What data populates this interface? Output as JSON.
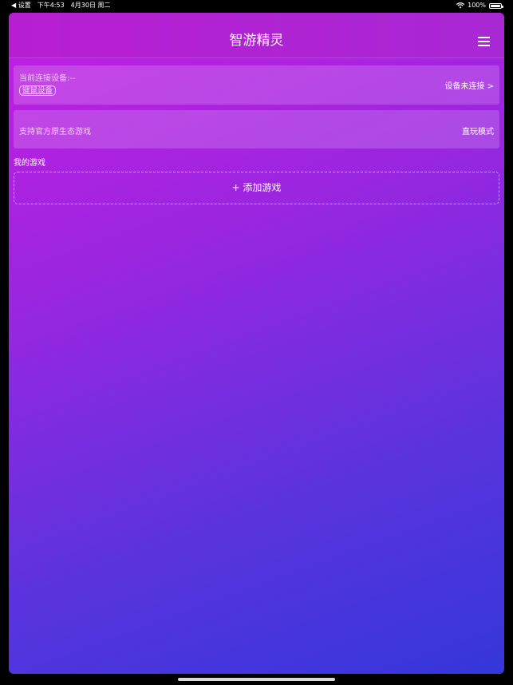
{
  "status_bar": {
    "back_label": "◀ 设置",
    "time": "下午4:53",
    "date": "4月30日 周二",
    "battery": "100%"
  },
  "app": {
    "title": "智游精灵"
  },
  "device_card": {
    "label": "当前连接设备:--",
    "tag": "键鼠设备",
    "status": "设备未连接 >"
  },
  "native_card": {
    "label": "支持官方原生态游戏",
    "mode": "直玩模式"
  },
  "games": {
    "section_title": "我的游戏",
    "add_label": "+ 添加游戏"
  }
}
